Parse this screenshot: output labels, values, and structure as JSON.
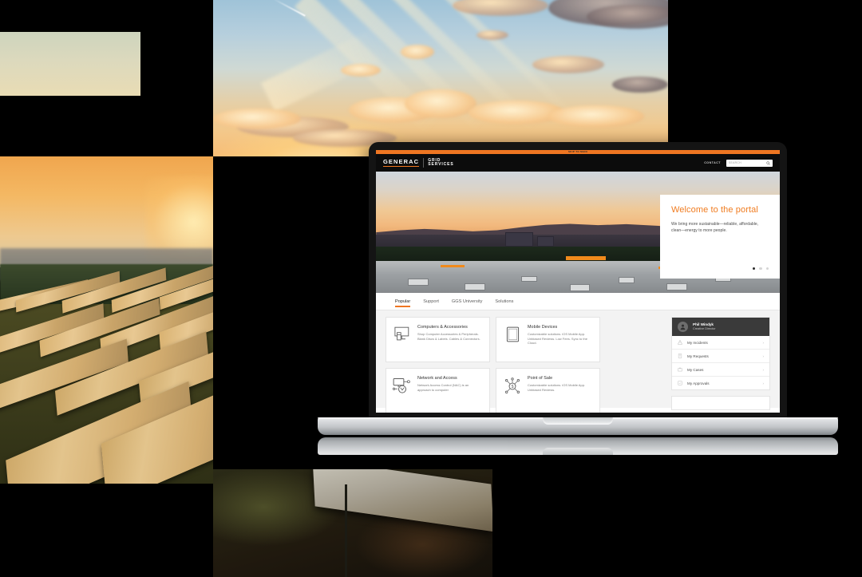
{
  "page": {
    "title": "Generac Grid Services portal shown on a laptop over solar energy photo collage"
  },
  "collage": {
    "swatch_label": "pale-sage-swatch",
    "photos": [
      {
        "name": "sunset-sky-photo",
        "caption": "Sunset sky with clouds, sun rays and a contrail"
      },
      {
        "name": "solar-farm-photo",
        "caption": "Rows of solar panels on a hillside at sunset"
      },
      {
        "name": "solar-panel-closeup-photo",
        "caption": "Close-up of a solar panel and fence post at dusk"
      }
    ]
  },
  "device": {
    "name": "laptop",
    "type": "silver notebook computer"
  },
  "site": {
    "topbar": {
      "label": "SKIP TO MAIN"
    },
    "brand": {
      "primary": "GENERAC",
      "secondary_line1": "GRID",
      "secondary_line2": "SERVICES"
    },
    "header": {
      "contact_label": "CONTACT",
      "search_placeholder": "SEARCH",
      "search_value": ""
    },
    "hero": {
      "heading": "Welcome to the portal",
      "body": "We bring more sustainable—reliable, affordable, clean—energy to more people.",
      "carousel": {
        "total": 3,
        "active_index": 0
      }
    },
    "tabs": [
      {
        "label": "Popular",
        "active": true
      },
      {
        "label": "Support",
        "active": false
      },
      {
        "label": "GGS University",
        "active": false
      },
      {
        "label": "Solutions",
        "active": false
      }
    ],
    "cards": [
      {
        "icon": "desktop-computer-icon",
        "title": "Computers & Accessories",
        "body": "Shop Computer Accessories & Peripherals. Blank Discs & Labels. Cables & Connectors."
      },
      {
        "icon": "tablet-icon",
        "title": "Mobile Devices",
        "body": "Customizable solutions. iOS Mobile App. Unbiased Reviews. Low Fees. Sync to the Cloud."
      },
      {
        "icon": "network-monitor-icon",
        "title": "Network and Access",
        "body": "Network Access Control (NAC) is an approach to computer"
      },
      {
        "icon": "point-of-sale-icon",
        "title": "Point of Sale",
        "body": "Customizable solutions. iOS Mobile App. Unbiased Reviews."
      }
    ],
    "sidebar": {
      "user": {
        "name": "Phil Windyk",
        "role": "Creative Director",
        "avatar_icon": "user-avatar-icon"
      },
      "items": [
        {
          "icon": "incident-icon",
          "label": "My Incidents",
          "chevron": "›"
        },
        {
          "icon": "request-icon",
          "label": "My Requests",
          "chevron": "›"
        },
        {
          "icon": "case-icon",
          "label": "My Cases",
          "chevron": "›"
        },
        {
          "icon": "approval-icon",
          "label": "My Approvals",
          "chevron": "›"
        }
      ]
    }
  },
  "colors": {
    "brand_orange": "#ef7622",
    "hero_heading": "#f07c20",
    "header_black": "#0c0c0c",
    "body_grey": "#f3f3f3",
    "user_panel_grey": "#3a3a3a"
  }
}
